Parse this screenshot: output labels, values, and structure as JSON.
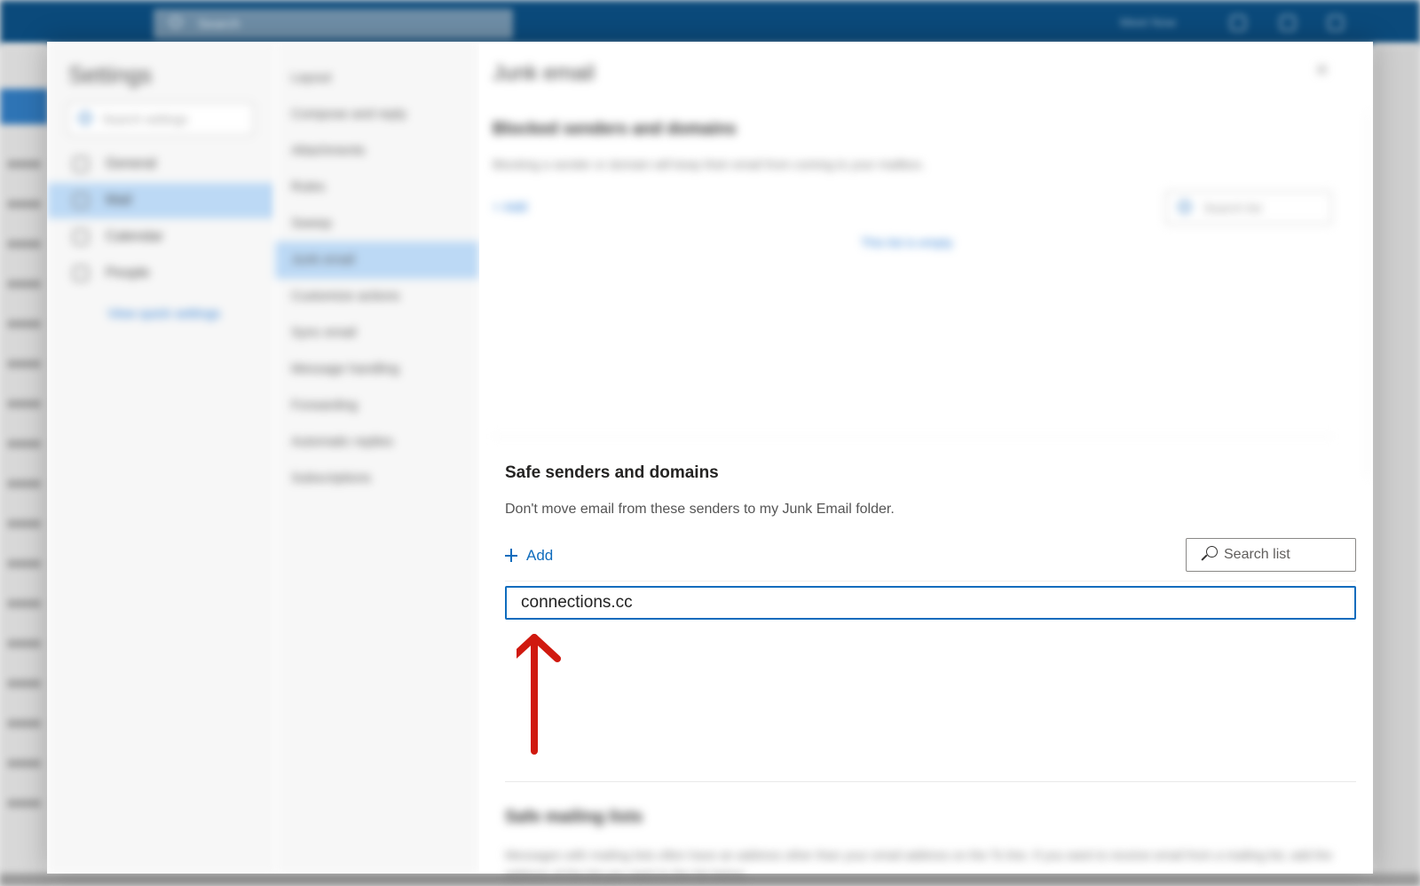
{
  "topbar": {
    "search_placeholder": "Search",
    "meet_label": "Meet Now"
  },
  "dialog": {
    "title": "Settings",
    "search_placeholder": "Search settings",
    "nav": [
      {
        "label": "General",
        "icon": "gear-icon"
      },
      {
        "label": "Mail",
        "icon": "mail-icon"
      },
      {
        "label": "Calendar",
        "icon": "calendar-icon"
      },
      {
        "label": "People",
        "icon": "people-icon"
      }
    ],
    "view_quick_settings": "View quick settings",
    "subnav": [
      "Layout",
      "Compose and reply",
      "Attachments",
      "Rules",
      "Sweep",
      "Junk email",
      "Customize actions",
      "Sync email",
      "Message handling",
      "Forwarding",
      "Automatic replies",
      "Subscriptions"
    ],
    "active_subnav": "Junk email"
  },
  "content": {
    "page_title": "Junk email",
    "blocked": {
      "title": "Blocked senders and domains",
      "description": "Blocking a sender or domain will keep their email from coming to your mailbox.",
      "add_label": "Add",
      "search_placeholder": "Search list",
      "empty_note": "This list is empty"
    },
    "safe": {
      "title": "Safe senders and domains",
      "description": "Don't move email from these senders to my Junk Email folder.",
      "add_label": "Add",
      "search_placeholder": "Search list",
      "entry_value": "connections.cc"
    },
    "mailing": {
      "title": "Safe mailing lists",
      "description": "Messages with mailing lists often have an address other than your email address on the To line. If you want to receive email from a mailing list, add the address of the list you want to the list below."
    }
  },
  "colors": {
    "topbar": "#0b4a7b",
    "accent": "#0f6cbd",
    "selection": "#bcd9f5",
    "annotation_arrow": "#d0190f"
  }
}
